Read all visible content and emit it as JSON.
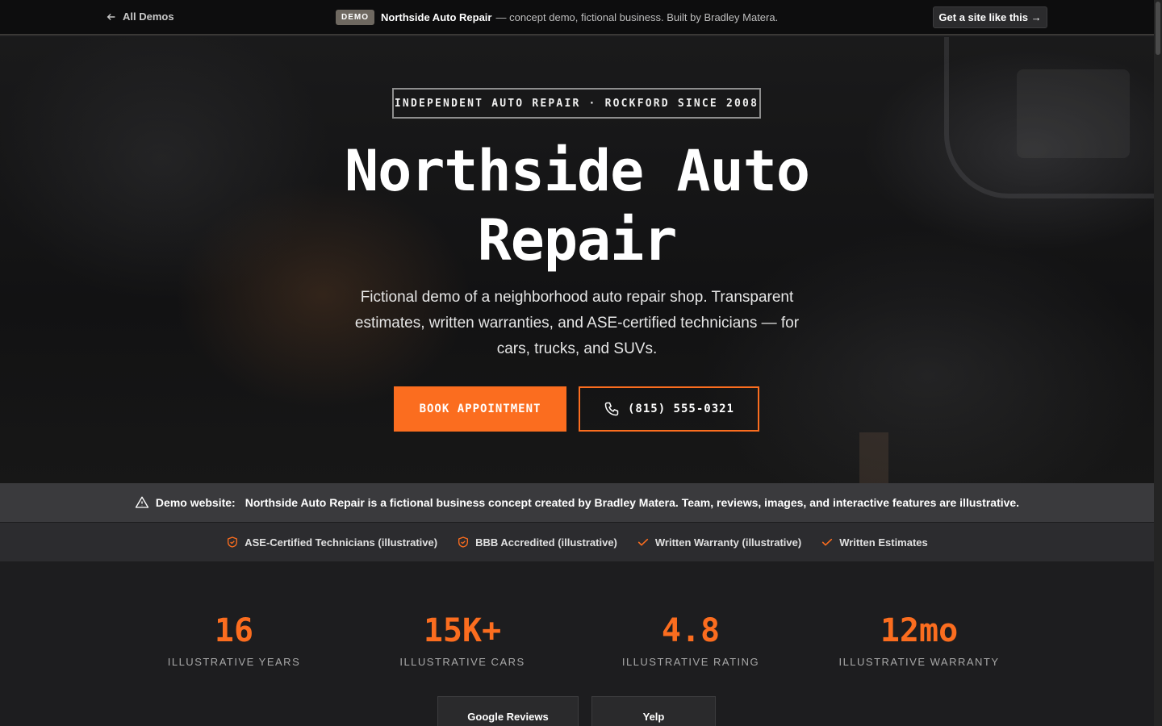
{
  "topbar": {
    "back_label": "All Demos",
    "demo_badge": "DEMO",
    "demo_business": "Northside Auto Repair",
    "demo_text": "— concept demo, fictional business. Built by Bradley Matera.",
    "cta_label": "Get a site like this →"
  },
  "hero": {
    "eyebrow": "INDEPENDENT AUTO REPAIR · ROCKFORD SINCE 2008",
    "title_line1": "Northside Auto",
    "title_line2": "Repair",
    "description": "Fictional demo of a neighborhood auto repair shop. Transparent estimates, written warranties, and ASE-certified technicians — for cars, trucks, and SUVs.",
    "book_label": "BOOK APPOINTMENT",
    "phone_label": "(815) 555-0321"
  },
  "demo_banner": {
    "label": "Demo website:",
    "text": "Northside Auto Repair is a fictional business concept created by Bradley Matera. Team, reviews, images, and interactive features are illustrative."
  },
  "trust": {
    "items": [
      {
        "label": "ASE-Certified Technicians (illustrative)",
        "icon": "shield-icon"
      },
      {
        "label": "BBB Accredited (illustrative)",
        "icon": "shield-icon"
      },
      {
        "label": "Written Warranty (illustrative)",
        "icon": "check-icon"
      },
      {
        "label": "Written Estimates",
        "icon": "check-icon"
      }
    ]
  },
  "stats": {
    "items": [
      {
        "value": "16",
        "label": "ILLUSTRATIVE YEARS"
      },
      {
        "value": "15K+",
        "label": "ILLUSTRATIVE CARS"
      },
      {
        "value": "4.8",
        "label": "ILLUSTRATIVE RATING"
      },
      {
        "value": "12mo",
        "label": "ILLUSTRATIVE WARRANTY"
      }
    ]
  },
  "reviews": {
    "google_label": "Google Reviews",
    "yelp_label": "Yelp"
  },
  "colors": {
    "accent": "#fb6d1f",
    "topbar_bg": "#0d0d0e",
    "banner_bg": "#3a3a3d"
  }
}
